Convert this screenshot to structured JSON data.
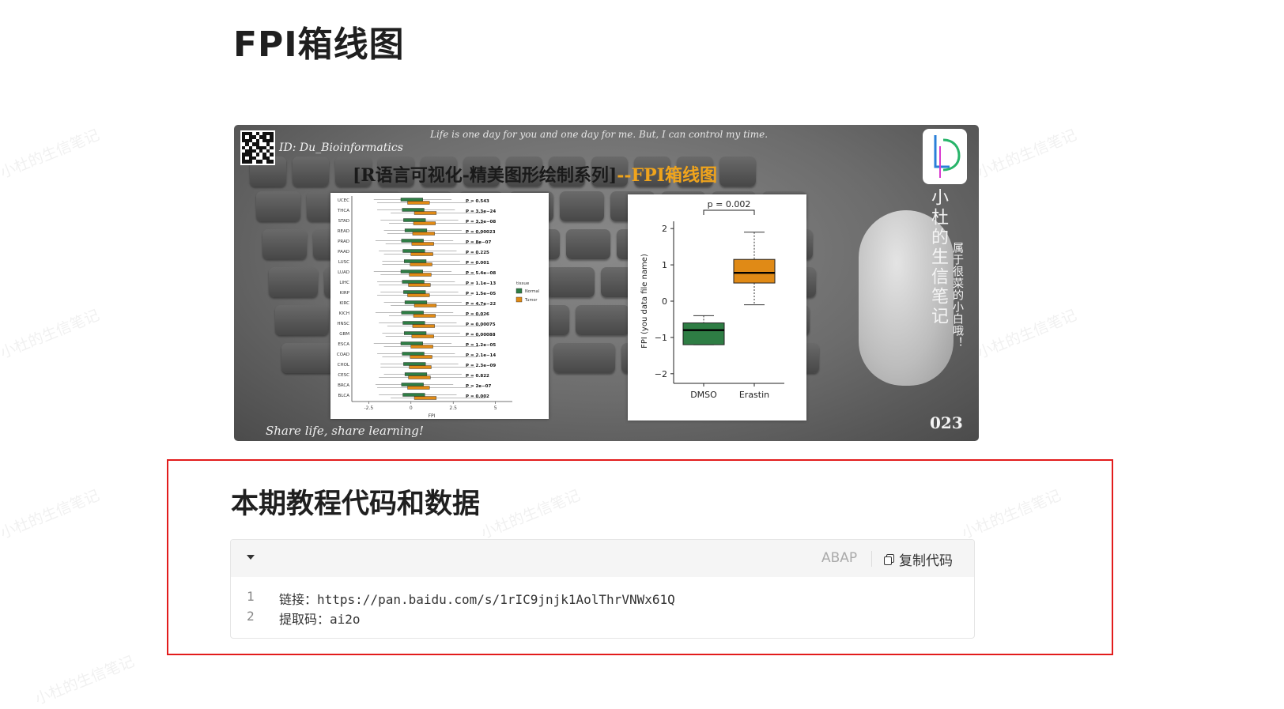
{
  "page": {
    "title": "FPI箱线图",
    "watermark": "小杜的生信笔记"
  },
  "banner": {
    "id_text": "ID: Du_Bioinformatics",
    "motto": "Life is one day for you and one day for me. But, I can control my time.",
    "heading_main": "[R语言可视化-精美图形绘制系列]",
    "heading_tail": "--FPI箱线图",
    "vertical_title": "小杜的生信笔记",
    "vertical_sub": "属于很菜的小白哦！",
    "footer_left": "Share life, share learning!",
    "footer_right": "023",
    "accent": "#f0a41c"
  },
  "chart_data": [
    {
      "type": "box",
      "orientation": "horizontal",
      "xlabel": "FPI",
      "x_ticks": [
        "-2.5",
        "0",
        "2.5",
        "5"
      ],
      "categories": [
        "UCEC",
        "THCA",
        "STAD",
        "READ",
        "PRAD",
        "PAAD",
        "LUSC",
        "LUAD",
        "LIHC",
        "KIRP",
        "KIRC",
        "KICH",
        "HNSC",
        "GBM",
        "ESCA",
        "COAD",
        "CHOL",
        "CESC",
        "BRCA",
        "BLCA"
      ],
      "pvalues": [
        "P = 0.543",
        "P = 3.3e−24",
        "P = 3.3e−08",
        "P = 0.00023",
        "P = 8e−07",
        "P = 0.225",
        "P = 0.001",
        "P = 5.4e−08",
        "P = 1.1e−13",
        "P = 1.5e−05",
        "P = 4.7e−22",
        "P = 0.026",
        "P = 0.00075",
        "P = 0.00088",
        "P = 1.2e−05",
        "P = 2.1e−14",
        "P = 2.3e−09",
        "P = 0.822",
        "P = 2e−07",
        "P = 0.002"
      ],
      "legend_title": "tissue",
      "series": [
        {
          "name": "Normal",
          "color": "#2e7d44"
        },
        {
          "name": "Tumor",
          "color": "#e08a16"
        }
      ]
    },
    {
      "type": "box",
      "ylabel": "FPI (you data file name)",
      "categories": [
        "DMSO",
        "Erastin"
      ],
      "ylim": [
        -2,
        2
      ],
      "y_ticks": [
        "2",
        "1",
        "0",
        "−1",
        "−2"
      ],
      "annotation": "p = 0.002",
      "boxes": [
        {
          "min": -1.2,
          "q1": -1.2,
          "median": -0.8,
          "q3": -0.6,
          "max": -0.4,
          "color": "#2e7d44"
        },
        {
          "min": -0.1,
          "q1": 0.5,
          "median": 0.78,
          "q3": 1.15,
          "max": 1.9,
          "color": "#e08a16"
        }
      ]
    }
  ],
  "section": {
    "heading": "本期教程代码和数据",
    "code": {
      "language": "ABAP",
      "copy_label": "复制代码",
      "lines": [
        {
          "n": "1",
          "text": "链接：https://pan.baidu.com/s/1rIC9jnjk1AolThrVNWx61Q"
        },
        {
          "n": "2",
          "text": "提取码：ai2o"
        }
      ]
    }
  }
}
